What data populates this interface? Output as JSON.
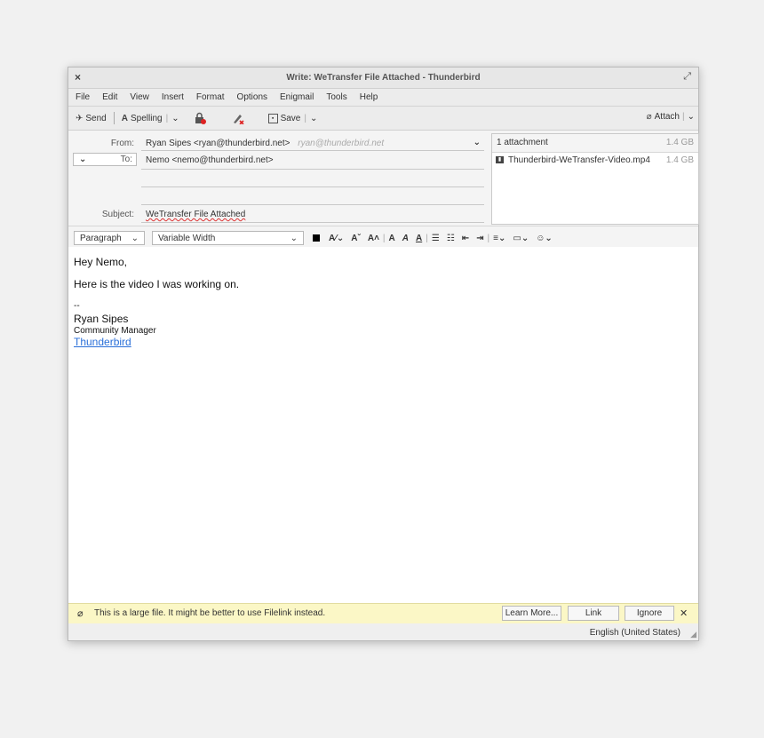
{
  "window": {
    "title": "Write: WeTransfer File Attached - Thunderbird",
    "close": "×",
    "maximize": "⤢"
  },
  "menu": [
    "File",
    "Edit",
    "View",
    "Insert",
    "Format",
    "Options",
    "Enigmail",
    "Tools",
    "Help"
  ],
  "toolbar": {
    "send": "Send",
    "spelling": "Spelling",
    "save": "Save",
    "attach": "Attach"
  },
  "header": {
    "from_label": "From:",
    "from_value": "Ryan Sipes <ryan@thunderbird.net>",
    "from_identity": "ryan@thunderbird.net",
    "to_label": "To:",
    "to_value": "Nemo <nemo@thunderbird.net>",
    "subject_label": "Subject:",
    "subject_value": "WeTransfer File Attached"
  },
  "attachments": {
    "header": "1 attachment",
    "total_size": "1.4 GB",
    "items": [
      {
        "name": "Thunderbird-WeTransfer-Video.mp4",
        "size": "1.4 GB"
      }
    ]
  },
  "format": {
    "paragraph": "Paragraph",
    "font": "Variable Width"
  },
  "message": {
    "greeting": "Hey Nemo,",
    "line": "Here is the video I was working on.",
    "sig_sep": "--",
    "sig_name": "Ryan Sipes",
    "sig_title": "Community Manager",
    "sig_link": "Thunderbird"
  },
  "notification": {
    "text": "This is a large file. It might be better to use Filelink instead.",
    "learn_more": "Learn More...",
    "link": "Link",
    "ignore": "Ignore",
    "close": "✕"
  },
  "status": {
    "language": "English (United States)"
  }
}
